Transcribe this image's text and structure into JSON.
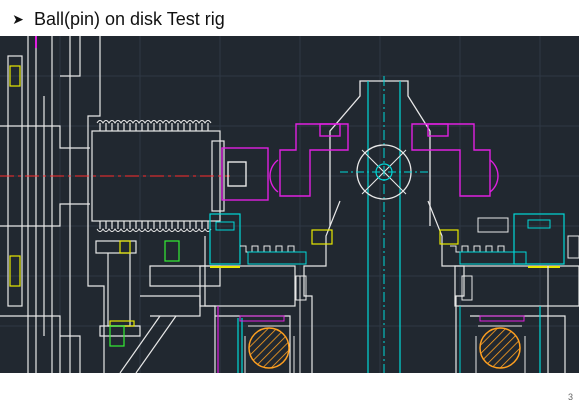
{
  "slide": {
    "bullet_icon": "arrowhead-bullet",
    "title": "Ball(pin) on disk Test rig",
    "page_number": "3"
  },
  "drawing": {
    "background": "#212830",
    "colors": {
      "outline": "#e8e8e8",
      "centerline": "#ff2b2b",
      "axis": "#00d8d8",
      "housing": "#e020e0",
      "bolt": "#e8e800",
      "spring": "#33ee33",
      "hatch": "#ffa020"
    }
  }
}
